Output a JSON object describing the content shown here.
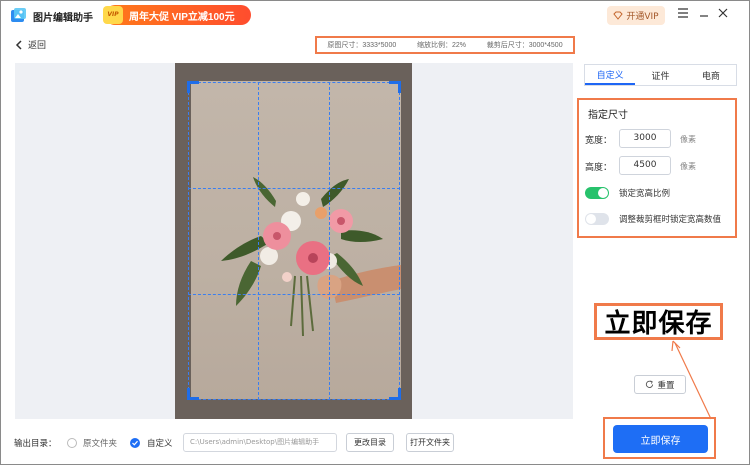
{
  "app": {
    "name": "图片编辑助手"
  },
  "promo": {
    "badge": "VIP",
    "text": "周年大促 VIP立减100元"
  },
  "header": {
    "vip_label": "开通VIP",
    "menu_icon": "menu-icon",
    "minimize_icon": "minimize-icon",
    "close_icon": "close-icon"
  },
  "nav": {
    "back_label": "返回"
  },
  "info": {
    "original_size": "原图尺寸：3333*5000",
    "zoom_ratio": "缩放比例：22%",
    "cropped_size": "裁剪后尺寸：3000*4500"
  },
  "tabs": [
    {
      "label": "自定义",
      "active": true
    },
    {
      "label": "证件",
      "active": false
    },
    {
      "label": "电商",
      "active": false
    }
  ],
  "size_panel": {
    "title": "指定尺寸",
    "width_label": "宽度：",
    "width_value": "3000",
    "height_label": "高度：",
    "height_value": "4500",
    "unit": "像素",
    "lock_ratio_label": "锁定宽高比例",
    "lock_ratio_on": true,
    "lock_values_label": "调整裁剪框时锁定宽高数值",
    "lock_values_on": false
  },
  "callout": {
    "text": "立即保存"
  },
  "actions": {
    "reset_label": "重置",
    "save_label": "立即保存"
  },
  "output": {
    "label": "输出目录：",
    "option_original": "原文件夹",
    "option_custom": "自定义",
    "selected": "自定义",
    "path": "C:\\Users\\admin\\Desktop\\图片编辑助手",
    "change_dir_label": "更改目录",
    "open_folder_label": "打开文件夹"
  },
  "colors": {
    "accent": "#1e6ef5",
    "highlight": "#f07a4a",
    "toggle_on": "#27c26c"
  }
}
